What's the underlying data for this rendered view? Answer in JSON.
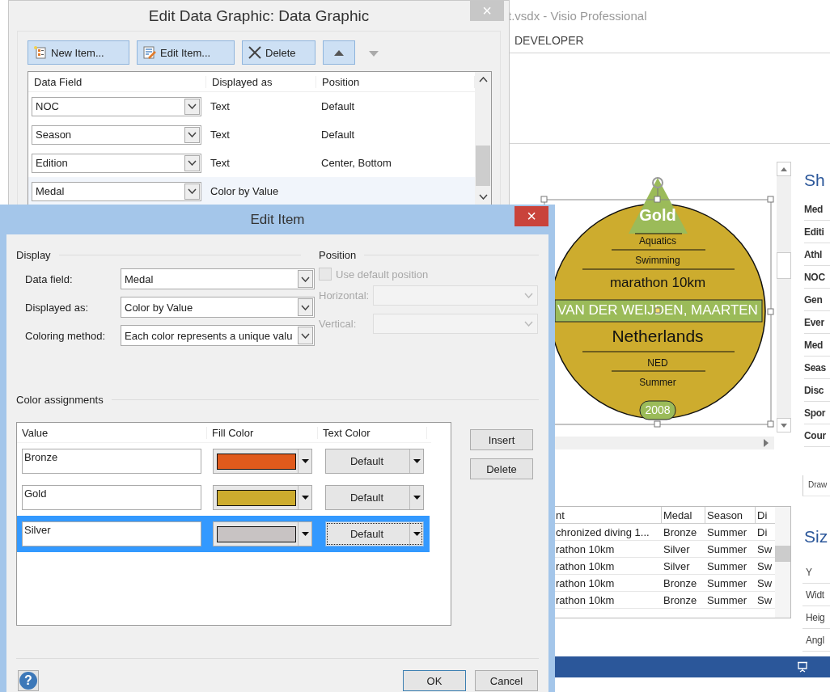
{
  "app": {
    "title": "t.vsdx - Visio Professional",
    "ribbon_tab": "DEVELOPER",
    "shape": [
      {
        "kind": "badge",
        "text": "Gold"
      },
      {
        "kind": "small",
        "text": "Aquatics"
      },
      {
        "kind": "small",
        "text": "Swimming"
      },
      {
        "kind": "medium",
        "text": "marathon 10km"
      },
      {
        "kind": "banner",
        "text": "VAN DER WEIJDEN, MAARTEN"
      },
      {
        "kind": "large",
        "text": "Netherlands"
      },
      {
        "kind": "small",
        "text": "NED"
      },
      {
        "kind": "small",
        "text": "Summer"
      },
      {
        "kind": "pill",
        "text": "2008"
      }
    ],
    "shape_data": {
      "title": "Sh",
      "rows": [
        "Med",
        "Editi",
        "Athl",
        "NOC",
        "Gen",
        "Ever",
        "Med",
        "Seas",
        "Disc",
        "Spor",
        "Cour"
      ]
    },
    "size_panel": {
      "tab": "Draw",
      "title": "Siz",
      "rows": [
        "Y",
        "Widt",
        "Heig",
        "Angl"
      ]
    },
    "data_table": {
      "columns": [
        "nt",
        "Medal",
        "Season",
        "Di"
      ],
      "rows": [
        [
          "chronized diving 1...",
          "Bronze",
          "Summer",
          "Di"
        ],
        [
          "rathon 10km",
          "Silver",
          "Summer",
          "Sw"
        ],
        [
          "rathon 10km",
          "Silver",
          "Summer",
          "Sw"
        ],
        [
          "rathon 10km",
          "Bronze",
          "Summer",
          "Sw"
        ],
        [
          "rathon 10km",
          "Bronze",
          "Summer",
          "Sw"
        ]
      ]
    }
  },
  "edit_data_graphic": {
    "title": "Edit Data Graphic: Data Graphic",
    "close": "×",
    "toolbar": [
      {
        "kind": "new",
        "label": "New Item...",
        "disabled": false
      },
      {
        "kind": "edit",
        "label": "Edit Item...",
        "disabled": false
      },
      {
        "kind": "delete",
        "label": "Delete",
        "disabled": false
      },
      {
        "kind": "up",
        "disabled": false
      },
      {
        "kind": "down",
        "disabled": true
      }
    ],
    "columns": [
      "Data Field",
      "Displayed as",
      "Position"
    ],
    "items": [
      {
        "field": "NOC",
        "displayed_as": "Text",
        "position": "Default",
        "selected": false
      },
      {
        "field": "Season",
        "displayed_as": "Text",
        "position": "Default",
        "selected": false
      },
      {
        "field": "Edition",
        "displayed_as": "Text",
        "position": "Center, Bottom",
        "selected": false
      },
      {
        "field": "Medal",
        "displayed_as": "Color by Value",
        "selected": true
      }
    ]
  },
  "edit_item": {
    "title": "Edit Item",
    "close": "×",
    "display": {
      "heading": "Display",
      "fields": [
        {
          "label": "Data field:",
          "value": "Medal"
        },
        {
          "label": "Displayed as:",
          "value": "Color by Value"
        },
        {
          "label": "Coloring method:",
          "value": "Each color represents a unique valu"
        }
      ]
    },
    "position": {
      "heading": "Position",
      "disabled": true,
      "use_default": {
        "label": "Use default position",
        "checked": false
      },
      "fields": [
        {
          "label": "Horizontal:"
        },
        {
          "label": "Vertical:"
        }
      ]
    },
    "color_assignments": {
      "heading": "Color assignments",
      "columns": [
        "Value",
        "Fill Color",
        "Text Color"
      ],
      "rows": [
        {
          "value": "Bronze",
          "color": "#e05a1c",
          "text_color": "Default",
          "selected": false
        },
        {
          "value": "Gold",
          "color": "#cdac2e",
          "text_color": "Default",
          "selected": false
        },
        {
          "value": "Silver",
          "color": "#c8c3c3",
          "text_color": "Default",
          "selected": true
        }
      ]
    },
    "side_buttons": [
      "Insert",
      "Delete"
    ],
    "help": "?",
    "buttons": [
      {
        "label": "OK",
        "default": true
      },
      {
        "label": "Cancel",
        "default": false
      }
    ]
  }
}
